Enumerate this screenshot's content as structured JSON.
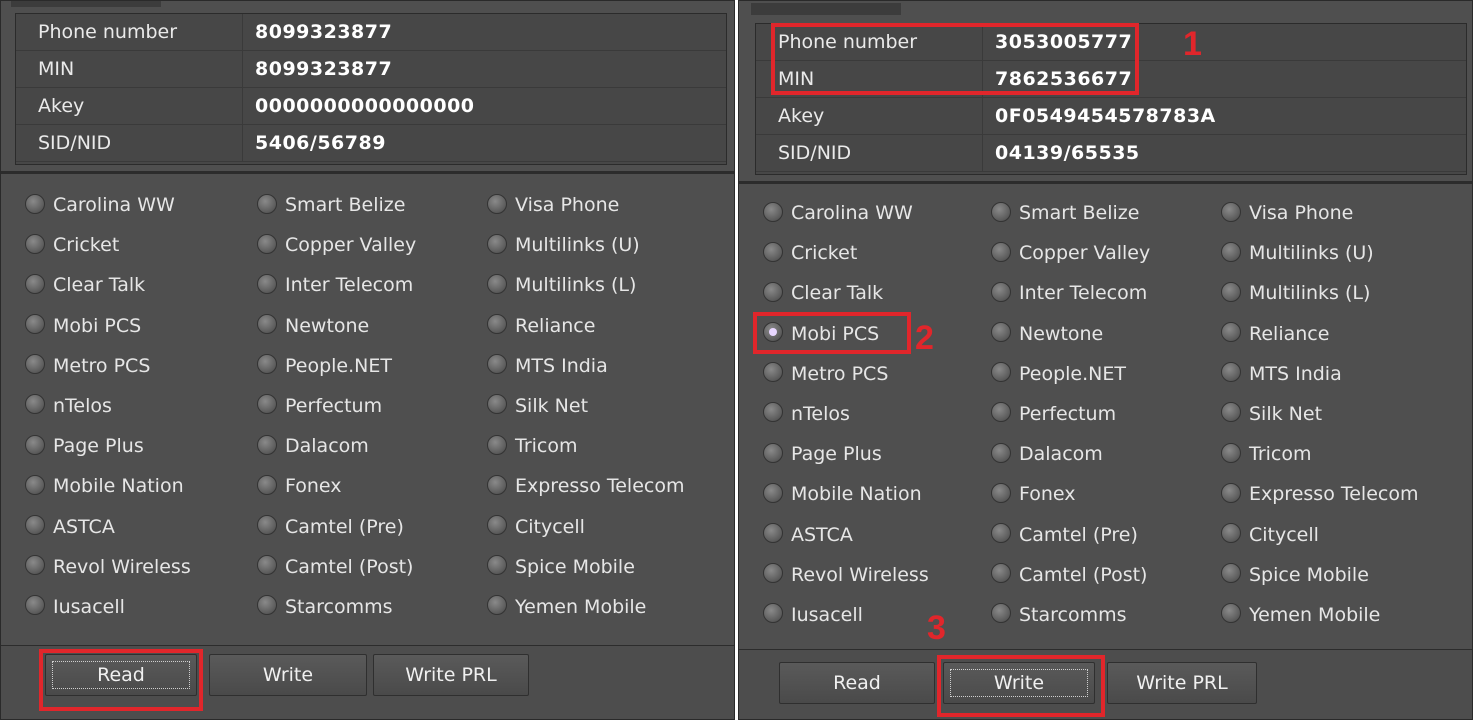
{
  "left": {
    "info": [
      {
        "label": "Phone number",
        "value": "8099323877"
      },
      {
        "label": "MIN",
        "value": "8099323877"
      },
      {
        "label": "Akey",
        "value": "0000000000000000"
      },
      {
        "label": "SID/NID",
        "value": "5406/56789"
      }
    ],
    "col1": [
      "Carolina WW",
      "Cricket",
      "Clear Talk",
      "Mobi PCS",
      "Metro PCS",
      "nTelos",
      "Page Plus",
      "Mobile Nation",
      "ASTCA",
      "Revol Wireless",
      "Iusacell"
    ],
    "col2": [
      "Smart Belize",
      "Copper Valley",
      "Inter Telecom",
      "Newtone",
      "People.NET",
      "Perfectum",
      "Dalacom",
      "Fonex",
      "Camtel (Pre)",
      "Camtel (Post)",
      "Starcomms"
    ],
    "col3": [
      "Visa Phone",
      "Multilinks (U)",
      "Multilinks (L)",
      "Reliance",
      "MTS India",
      "Silk Net",
      "Tricom",
      "Expresso Telecom",
      "Citycell",
      "Spice Mobile",
      "Yemen  Mobile"
    ],
    "buttons": {
      "read": "Read",
      "write": "Write",
      "write_prl": "Write PRL"
    }
  },
  "right": {
    "info": [
      {
        "label": "Phone number",
        "value": "3053005777"
      },
      {
        "label": "MIN",
        "value": "7862536677"
      },
      {
        "label": "Akey",
        "value": "0F0549454578783A"
      },
      {
        "label": "SID/NID",
        "value": "04139/65535"
      }
    ],
    "col1": [
      "Carolina WW",
      "Cricket",
      "Clear Talk",
      "Mobi PCS",
      "Metro PCS",
      "nTelos",
      "Page Plus",
      "Mobile Nation",
      "ASTCA",
      "Revol Wireless",
      "Iusacell"
    ],
    "col2": [
      "Smart Belize",
      "Copper Valley",
      "Inter Telecom",
      "Newtone",
      "People.NET",
      "Perfectum",
      "Dalacom",
      "Fonex",
      "Camtel (Pre)",
      "Camtel (Post)",
      "Starcomms"
    ],
    "col3": [
      "Visa Phone",
      "Multilinks (U)",
      "Multilinks (L)",
      "Reliance",
      "MTS India",
      "Silk Net",
      "Tricom",
      "Expresso Telecom",
      "Citycell",
      "Spice Mobile",
      "Yemen  Mobile"
    ],
    "selected": "Mobi PCS",
    "buttons": {
      "read": "Read",
      "write": "Write",
      "write_prl": "Write PRL"
    }
  },
  "annotations": {
    "step1": "1",
    "step2": "2",
    "step3": "3"
  },
  "colors": {
    "highlight": "#e1262b",
    "panel": "#4f4f4f"
  }
}
